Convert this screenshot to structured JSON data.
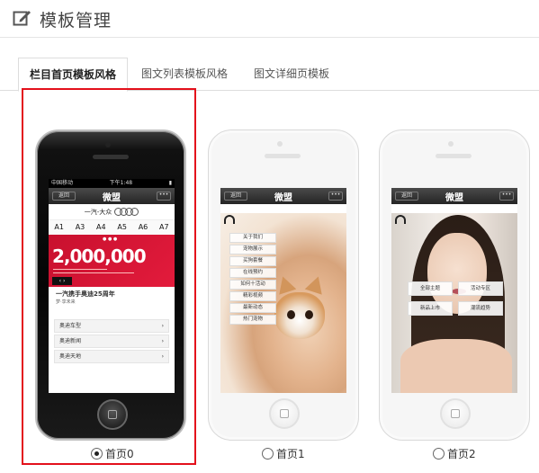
{
  "page": {
    "title": "模板管理"
  },
  "tabs": [
    {
      "label": "栏目首页模板风格",
      "active": true
    },
    {
      "label": "图文列表模板风格",
      "active": false
    },
    {
      "label": "图文详细页模板",
      "active": false
    }
  ],
  "templates": [
    {
      "label": "首页0",
      "selected": true
    },
    {
      "label": "首页1",
      "selected": false
    },
    {
      "label": "首页2",
      "selected": false
    }
  ],
  "preview": {
    "nav_back": "返回",
    "nav_title": "微盟",
    "nav_more": "•••",
    "status_left": "中国移动",
    "status_time": "下午1:48",
    "home0": {
      "brand": "一汽-大众",
      "models": [
        "A1",
        "A3",
        "A4",
        "A5",
        "A6",
        "A7"
      ],
      "banner_number": "2,000,000",
      "heading": "一汽携手奥迪25周年",
      "subheading": "梦·享未来",
      "rows": [
        "奥迪车型",
        "奥迪新闻",
        "奥迪天地"
      ]
    },
    "home1": {
      "menu": [
        "关于我们",
        "宠物展示",
        "买狗套餐",
        "在线预约",
        "如何十活动",
        "精彩视频",
        "最新动态",
        "热门宠物"
      ]
    },
    "home2": {
      "buttons": [
        "全部主题",
        "活动专区",
        "新品上市",
        "潮流趋势"
      ]
    }
  },
  "colors": {
    "selection_border": "#e3101b",
    "banner_red": "#c8102e"
  }
}
